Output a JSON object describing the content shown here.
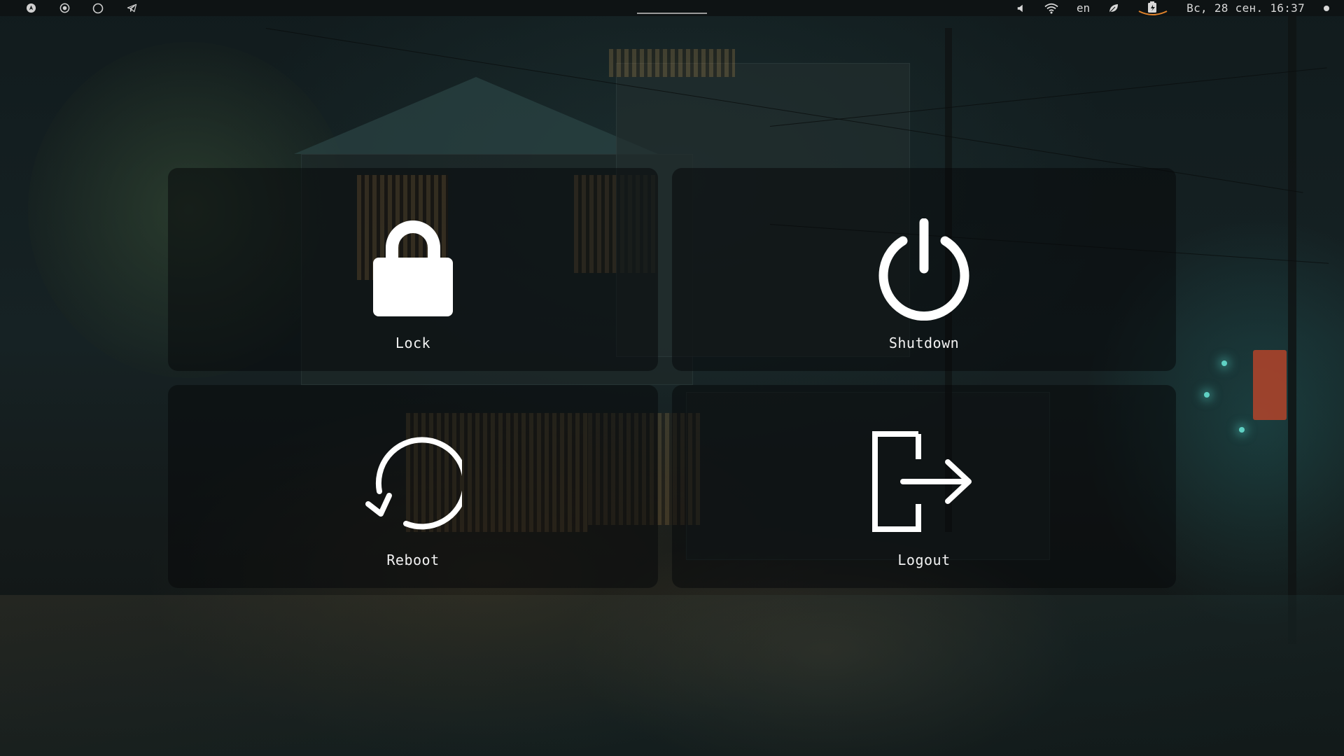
{
  "top_bar": {
    "workspaces": [
      {
        "icon": "arch-logo-icon"
      },
      {
        "icon": "circle-dot-icon"
      },
      {
        "icon": "circle-icon"
      },
      {
        "icon": "telegram-icon"
      }
    ],
    "tray": {
      "volume_icon": "speaker-icon",
      "wifi_icon": "wifi-icon",
      "language": "en",
      "leaf_icon": "leaf-icon",
      "battery_icon": "battery-charging-icon",
      "clock": "Вс, 28 сен. 16:37",
      "notification_icon": "dot-icon"
    }
  },
  "power_menu": {
    "lock": {
      "label": "Lock",
      "icon": "lock-icon"
    },
    "shutdown": {
      "label": "Shutdown",
      "icon": "power-icon"
    },
    "reboot": {
      "label": "Reboot",
      "icon": "reboot-icon"
    },
    "logout": {
      "label": "Logout",
      "icon": "logout-icon"
    }
  },
  "colors": {
    "tile_bg": "#08090b",
    "icon": "#ffffff",
    "battery_accent": "#e0822a"
  }
}
